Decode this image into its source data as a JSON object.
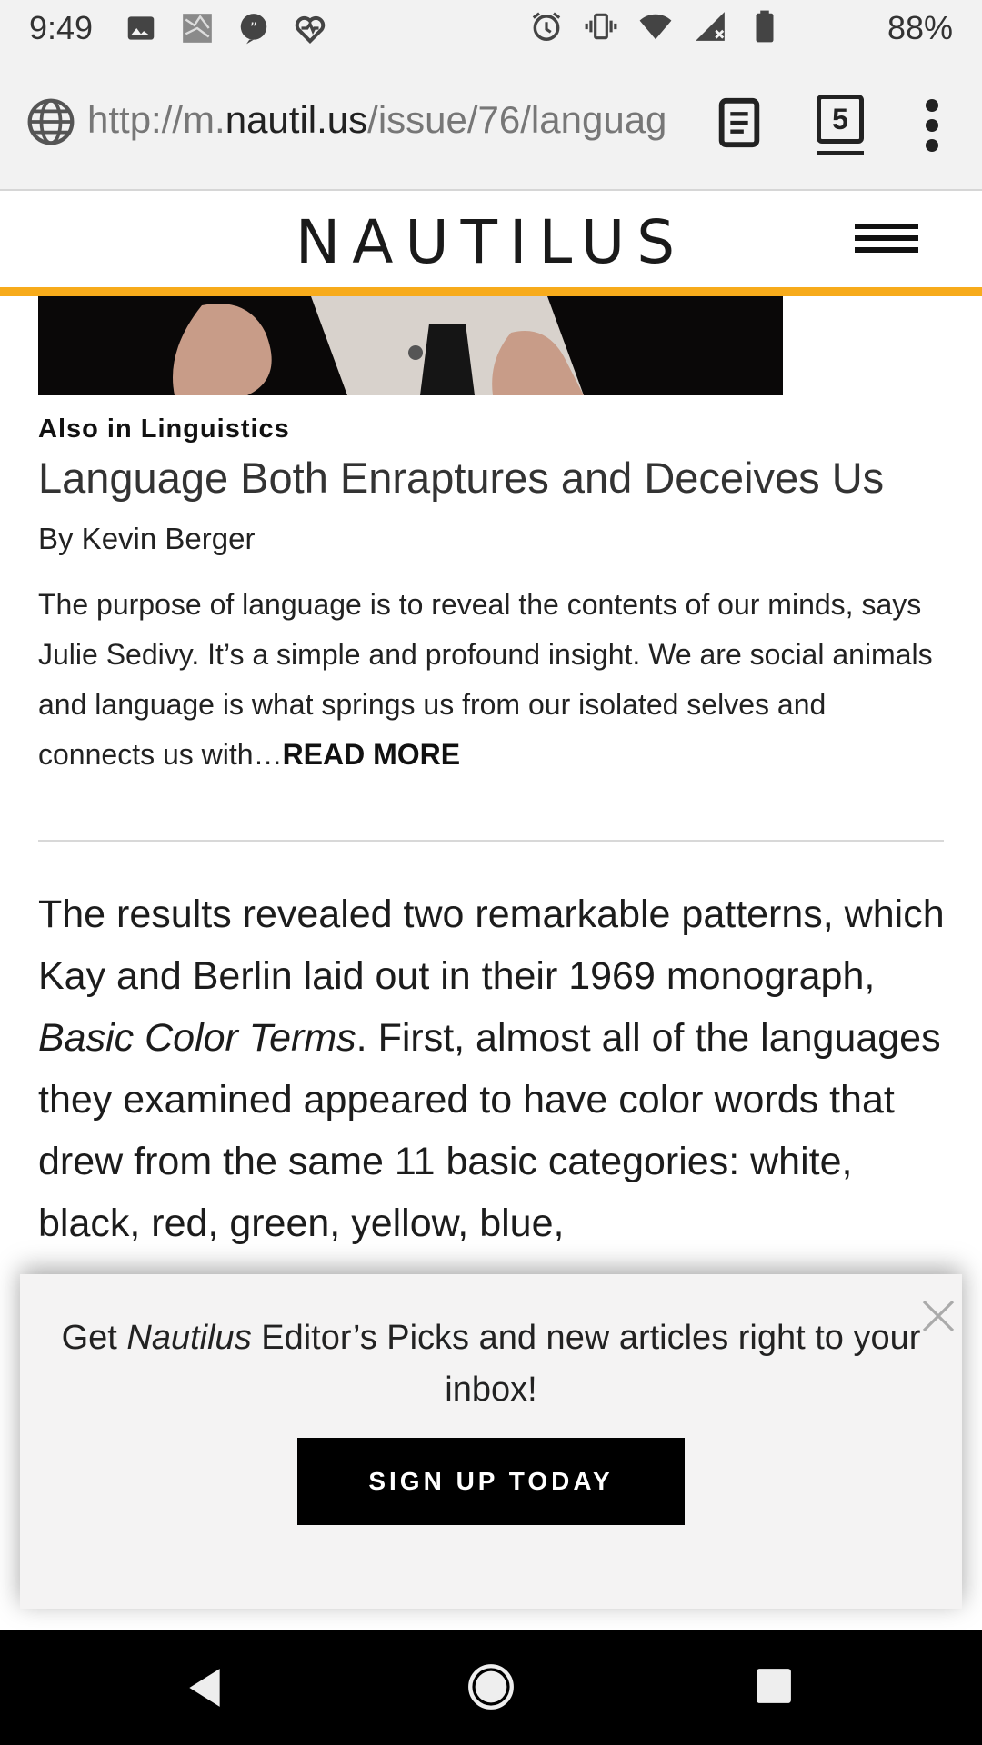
{
  "status_bar": {
    "time": "9:49",
    "battery_percent": "88%",
    "left_icons": [
      "image-icon",
      "photo-thumbnail-icon",
      "chat-bubble-icon",
      "heart-pulse-icon"
    ],
    "right_icons": [
      "alarm-icon",
      "vibrate-icon",
      "wifi-icon",
      "signal-icon",
      "battery-icon"
    ]
  },
  "browser": {
    "url_prefix": "http://m.",
    "url_host": "nautil.us",
    "url_path": "/issue/76/languag",
    "tab_count": "5"
  },
  "site": {
    "logo": "NAUTILUS",
    "accent_color": "#f7ab1b"
  },
  "related": {
    "section_label": "Also in Linguistics",
    "title": "Language Both Enraptures and Deceives Us",
    "byline": "By Kevin Berger",
    "excerpt": "The purpose of language is to reveal the contents of our minds, says Julie Sedivy. It’s a simple and profound insight. We are social animals and language is what springs us from our isolated selves and connects us with…",
    "read_more": "READ MORE"
  },
  "article": {
    "para_start": "The results revealed two remarkable patterns, which Kay and Berlin laid out in their 1969 monograph, ",
    "para_italic": "Basic Color Terms",
    "para_end": ". First, almost all of the languages they examined appeared to have color words that drew from the same 11 basic categories: white, black, red, green, yellow, blue,"
  },
  "popup": {
    "text_before": "Get ",
    "text_italic": "Nautilus",
    "text_after": " Editor’s Picks and new articles right to your inbox!",
    "button_label": "SIGN UP TODAY"
  }
}
